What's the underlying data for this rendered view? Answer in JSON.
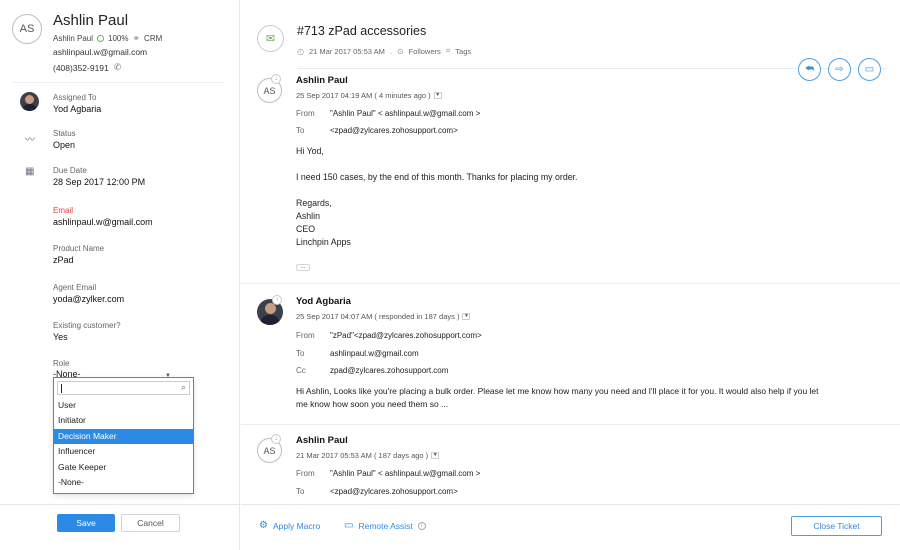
{
  "contact": {
    "initials": "AS",
    "name": "Ashlin Paul",
    "account": "Ashlin Paul",
    "score": "100%",
    "crm_label": "CRM",
    "email": "ashlinpaul.w@gmail.com",
    "phone": "(408)352-9191"
  },
  "fields": {
    "assigned_to_label": "Assigned To",
    "assigned_to_value": "Yod Agbaria",
    "status_label": "Status",
    "status_value": "Open",
    "due_date_label": "Due Date",
    "due_date_value": "28 Sep 2017 12:00 PM",
    "email_label": "Email",
    "email_value": "ashlinpaul.w@gmail.com",
    "product_label": "Product Name",
    "product_value": "zPad",
    "agent_email_label": "Agent Email",
    "agent_email_value": "yoda@zylker.com",
    "existing_label": "Existing customer?",
    "existing_value": "Yes",
    "role_label": "Role",
    "role_value": "-None-"
  },
  "role_dropdown": {
    "search_value": "",
    "options": [
      "User",
      "Initiator",
      "Decision Maker",
      "Influencer",
      "Gate Keeper",
      "-None-"
    ],
    "selected": "Decision Maker"
  },
  "left_footer": {
    "save_label": "Save",
    "cancel_label": "Cancel"
  },
  "ticket": {
    "title": "#713  zPad accessories",
    "created": "21 Mar 2017 05:53 AM",
    "separator": ".",
    "followers_label": "Followers",
    "tags_label": "Tags"
  },
  "threads": [
    {
      "initials": "AS",
      "sender": "Ashlin Paul",
      "date": "25 Sep 2017 04:19 AM ( 4 minutes ago )",
      "from_label": "From",
      "from": "\"Ashlin Paul\" < ashlinpaul.w@gmail.com >",
      "to_label": "To",
      "to": "<zpad@zylcares.zohosupport.com>",
      "body": [
        "Hi Yod,",
        "",
        "I need 150 cases, by the end of this month. Thanks for placing my order.",
        "",
        "Regards,",
        "Ashlin",
        "CEO",
        "Linchpin Apps"
      ],
      "more_label": "..."
    },
    {
      "sender": "Yod Agbaria",
      "date": "25 Sep 2017 04:07 AM ( responded in 187 days )",
      "from_label": "From",
      "from": "\"zPad\"<zpad@zylcares.zohosupport.com>",
      "to_label": "To",
      "to": "ashlinpaul.w@gmail.com",
      "cc_label": "Cc",
      "cc": "zpad@zylcares.zohosupport.com",
      "body": [
        "Hi Ashlin, Looks like you're placing a bulk order. Please let me know how many you need and I'll place it for you. It would also help if you let",
        "me know how soon you need them so ..."
      ]
    },
    {
      "initials": "AS",
      "sender": "Ashlin Paul",
      "date": "21 Mar 2017 05:53 AM ( 187 days ago )",
      "from_label": "From",
      "from": "\"Ashlin Paul\" < ashlinpaul.w@gmail.com >",
      "to_label": "To",
      "to": "<zpad@zylcares.zohosupport.com>"
    }
  ],
  "right_footer": {
    "apply_macro_label": "Apply Macro",
    "remote_assist_label": "Remote Assist",
    "close_ticket_label": "Close Ticket"
  },
  "colors": {
    "accent": "#2d8ae4",
    "required": "#e2473b",
    "score_green": "#6bb35a"
  }
}
